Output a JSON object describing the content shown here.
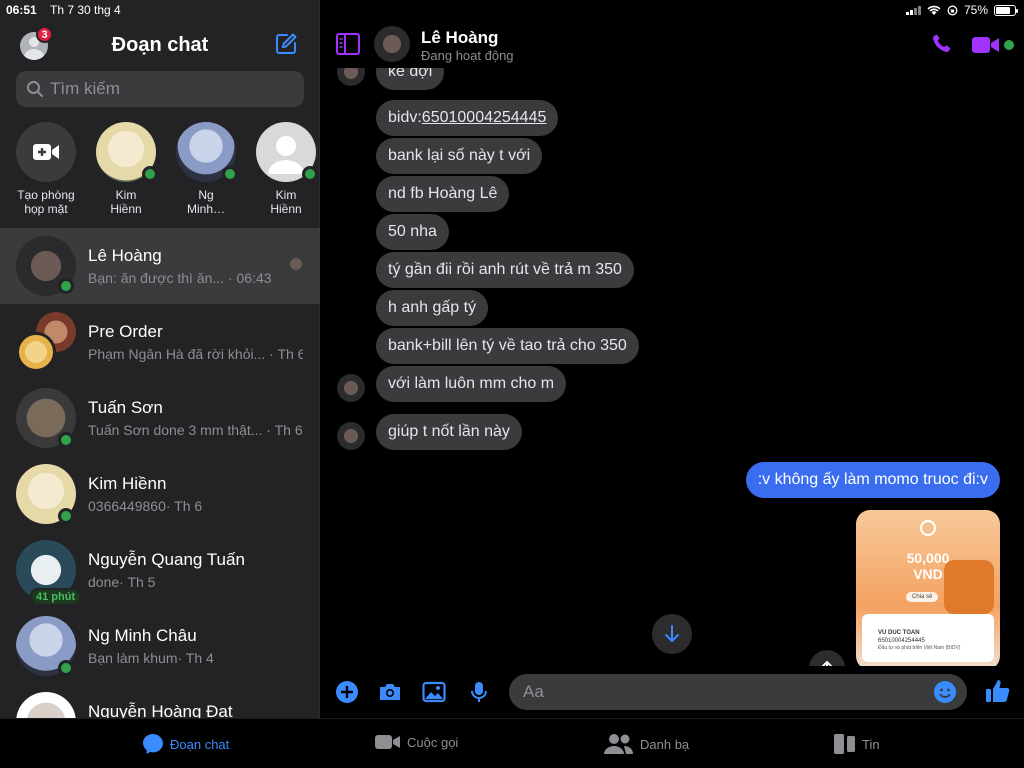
{
  "status_bar": {
    "time": "06:51",
    "date": "Th 7 30 thg 4",
    "battery": "75%",
    "battery_level": 0.75
  },
  "sidebar": {
    "title": "Đoạn chat",
    "badge": "3",
    "search_placeholder": "Tìm kiếm",
    "stories": [
      {
        "label_line1": "Tạo phòng",
        "label_line2": "họp mặt",
        "icon": "video-plus-icon"
      },
      {
        "label_line1": "Kim",
        "label_line2": "Hiềnn",
        "online": true
      },
      {
        "label_line1": "Ng",
        "label_line2": "Minh…",
        "online": true
      },
      {
        "label_line1": "Kim",
        "label_line2": "Hiềnn",
        "online": true
      }
    ],
    "conversations": [
      {
        "name": "Lê Hoàng",
        "snippet": "Bạn: ăn được thì ăn... · 06:43",
        "online": true,
        "active": true
      },
      {
        "name": "Pre Order",
        "snippet": "Phạm Ngân Hà đã rời khỏi... · Th 6",
        "online": false
      },
      {
        "name": "Tuấn Sơn",
        "snippet": "Tuấn Sơn done 3 mm thật... · Th 6",
        "online": true
      },
      {
        "name": "Kim Hiềnn",
        "snippet": "0366449860· Th 6",
        "online": true
      },
      {
        "name": "Nguyễn Quang Tuấn",
        "snippet": "done· Th 5",
        "online": false,
        "time_tag": "41 phút"
      },
      {
        "name": "Ng Minh Châu",
        "snippet": "Bạn làm khum· Th 4",
        "online": true
      },
      {
        "name": "Nguyễn Hoàng Đạt",
        "snippet": "",
        "online": false
      }
    ]
  },
  "chat": {
    "contact_name": "Lê Hoàng",
    "contact_status": "Đang hoạt động",
    "messages": [
      {
        "text": "kê đợi",
        "dir": "in"
      },
      {
        "text_prefix": "bidv:",
        "text_link": "65010004254445",
        "dir": "in"
      },
      {
        "text": "bank lại số này t với",
        "dir": "in"
      },
      {
        "text": "nd fb Hoàng Lê",
        "dir": "in"
      },
      {
        "text": "50 nha",
        "dir": "in"
      },
      {
        "text": "tý gần đii rồi anh rút về trả m 350",
        "dir": "in"
      },
      {
        "text": "h anh gấp tý",
        "dir": "in"
      },
      {
        "text": "bank+bill lên tý về tao trả cho 350",
        "dir": "in"
      },
      {
        "text": "với làm luôn mm cho m",
        "dir": "in"
      },
      {
        "text": "giúp t nốt lần này",
        "dir": "in"
      },
      {
        "text": ":v không ấy làm momo truoc đi:v",
        "dir": "out"
      }
    ],
    "receipt": {
      "amount": "50,000 VND",
      "share": "Chia sẻ",
      "recipient": "VU DUC TOAN",
      "account": "65010004254445",
      "bank": "Đầu tư và phát triển Việt Nam (BIDV)"
    },
    "composer_placeholder": "Aa"
  },
  "tabbar": {
    "tabs": [
      {
        "label": "Đoạn chat",
        "active": true
      },
      {
        "label": "Cuộc gọi",
        "active": false
      },
      {
        "label": "Danh bạ",
        "active": false
      },
      {
        "label": "Tin",
        "active": false
      }
    ]
  },
  "colors": {
    "accent": "#3a8bfe",
    "purple": "#a033ff",
    "bubble_in": "#3a3b3d",
    "bubble_out": "#3a6df0",
    "online": "#31a24c"
  }
}
